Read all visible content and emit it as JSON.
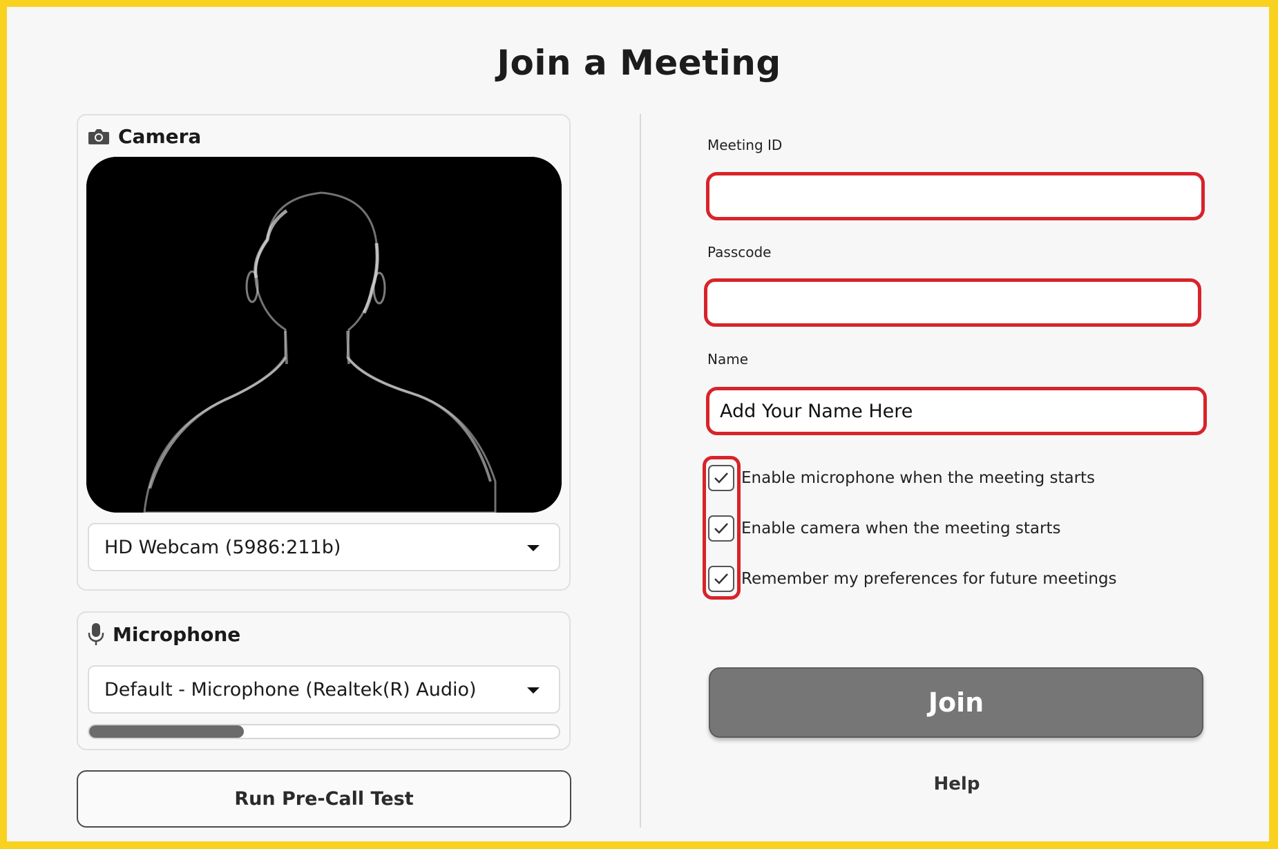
{
  "page": {
    "title": "Join a Meeting"
  },
  "camera": {
    "header": "Camera",
    "header_icon": "camera-icon",
    "selected_device": "HD Webcam (5986:211b)"
  },
  "microphone": {
    "header": "Microphone",
    "header_icon": "microphone-icon",
    "selected_device": "Default - Microphone (Realtek(R) Audio)",
    "input_level_fraction": 0.33
  },
  "pre_call_test_label": "Run Pre-Call Test",
  "form": {
    "meeting_id": {
      "label": "Meeting ID",
      "value": ""
    },
    "passcode": {
      "label": "Passcode",
      "value": ""
    },
    "name": {
      "label": "Name",
      "placeholder": "Add Your Name Here"
    },
    "options": [
      {
        "label": "Enable microphone when the meeting starts",
        "checked": true
      },
      {
        "label": "Enable camera when the meeting starts",
        "checked": true
      },
      {
        "label": "Remember my preferences for future meetings",
        "checked": true
      }
    ]
  },
  "join_label": "Join",
  "help_label": "Help",
  "colors": {
    "frame_border": "#f9d21f",
    "highlight_red": "#d8232a",
    "join_button": "#767676",
    "level_fill": "#6b6b6b"
  }
}
